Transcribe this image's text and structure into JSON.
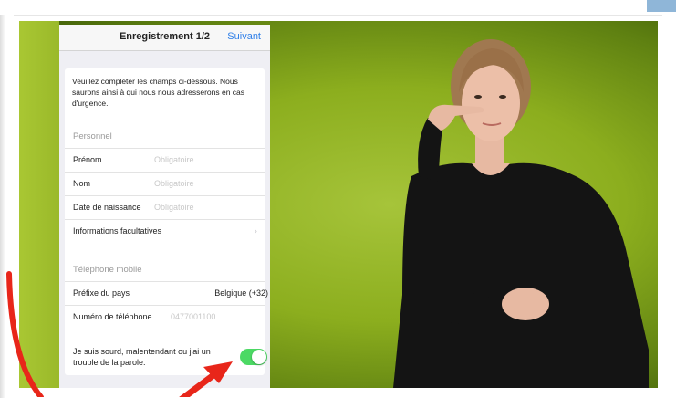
{
  "form": {
    "title": "Enregistrement 1/2",
    "next_label": "Suivant",
    "intro_text": "Veuillez compléter les champs ci-dessous. Nous saurons ainsi à qui nous nous adresserons en cas d'urgence.",
    "personal_section": {
      "header": "Personnel",
      "fields": [
        {
          "label": "Prénom",
          "placeholder": "Obligatoire"
        },
        {
          "label": "Nom",
          "placeholder": "Obligatoire"
        },
        {
          "label": "Date de naissance",
          "placeholder": "Obligatoire"
        }
      ],
      "optional_label": "Informations facultatives"
    },
    "phone_section": {
      "header": "Téléphone mobile",
      "country_label": "Préfixe du pays",
      "country_value": "Belgique (+32)",
      "number_label": "Numéro de téléphone",
      "number_placeholder": "0477001100"
    },
    "deaf_toggle": {
      "label": "Je suis sourd, malentendant ou j'ai un trouble de la parole.",
      "state": "on"
    }
  },
  "colors": {
    "accent": "#2f7fe8",
    "toggle_on": "#4cd964",
    "annotation": "#e8261a",
    "background_green": "#9ab92a"
  }
}
